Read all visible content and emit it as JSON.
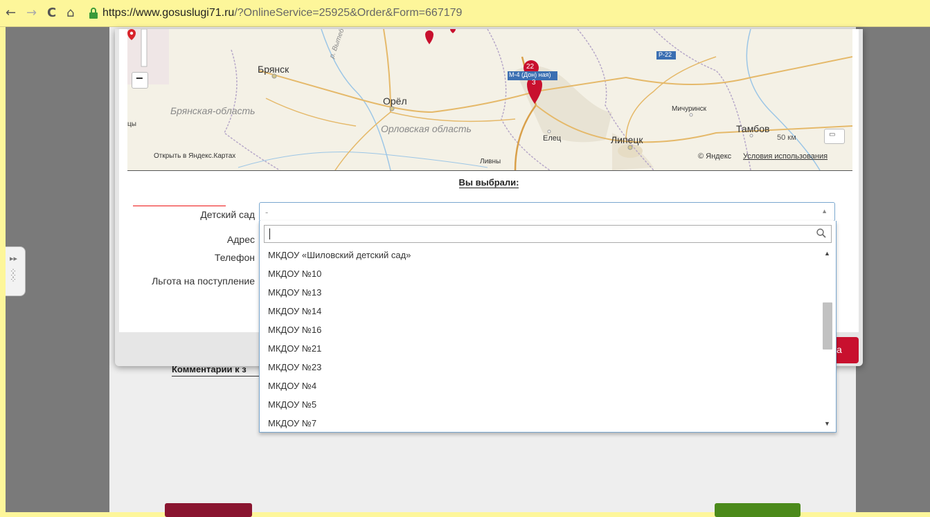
{
  "browser": {
    "back_icon": "←",
    "forward_icon": "→",
    "reload_icon": "C",
    "home_icon": "⌂",
    "url_host": "https://www.gosuslugi71.ru",
    "url_path": "/?OnlineService=25925&Order&Form=667179"
  },
  "map": {
    "labels": {
      "bryansk": "Брянск",
      "bryansk_region": "Брянская-область",
      "orel": "Орёл",
      "orel_region": "Орловская область",
      "lipetsk": "Липецк",
      "tambov": "Тамбов",
      "michurinsk": "Мичуринск",
      "elets": "Елец",
      "livny": "Ливны",
      "river": "р. Вытебеть",
      "road_m4": "М-4 (Дон) ная)",
      "road_p22": "Р-22",
      "cluster_22": "22",
      "cluster_3": "3",
      "edge_left": "цы",
      "scale": "50 км",
      "copyright": "© Яндекс",
      "terms": "Условия использования",
      "open_yandex": "Открыть в Яндекс.Картах",
      "zoom_out": "−"
    }
  },
  "form": {
    "chosen_title": "Вы выбрали:",
    "kindergarten_label": "Детский сад",
    "address_label": "Адрес",
    "phone_label": "Телефон",
    "benefit_label": "Льгота на поступление",
    "select_value": "-",
    "search_value": ""
  },
  "dropdown": {
    "options": [
      "МКДОУ «Шиловский детский сад»",
      "МКДОУ №10",
      "МКДОУ №13",
      "МКДОУ №14",
      "МКДОУ №16",
      "МКДОУ №21",
      "МКДОУ №23",
      "МКДОУ №4",
      "МКДОУ №5",
      "МКДОУ №7"
    ]
  },
  "background": {
    "comment_label": "Комментарии к з",
    "modal_button_fragment": "а"
  }
}
